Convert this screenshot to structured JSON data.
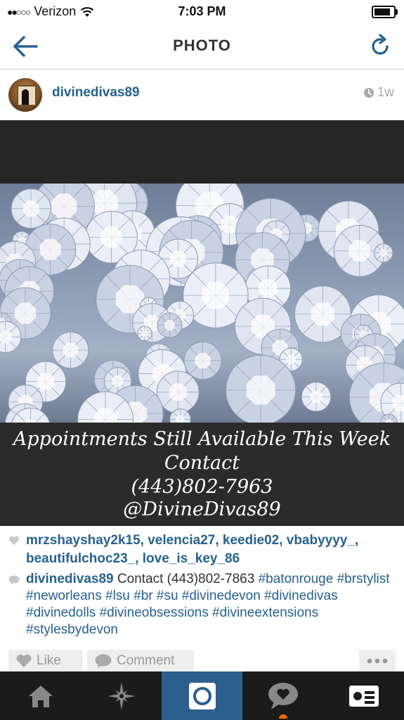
{
  "status_bar": {
    "signal_dots": "●●○○○",
    "carrier": "Verizon",
    "time": "7:03 PM",
    "battery_level": 0.85
  },
  "nav": {
    "title": "PHOTO",
    "back_icon": "arrow-left-icon",
    "refresh_icon": "refresh-icon"
  },
  "post": {
    "username": "divinedivas89",
    "time_ago": "1w",
    "image_caption": [
      "Appointments Still Available This Week",
      "Contact",
      "(443)802-7963",
      "@DivineDivas89"
    ],
    "likes": "mrzshayshay2k15, velencia27, keedie02, vbabyyyy_, beautifulchoc23_, love_is_key_86",
    "comment": {
      "username": "divinedivas89",
      "text": "Contact (443)802-7863",
      "hashtags": "#batonrouge #brstylist #neworleans #lsu #br #su #divinedevon #divinedivas #divinedolls #divineobsessions #divineextensions #stylesbydevon"
    }
  },
  "actions": {
    "like_label": "Like",
    "comment_label": "Comment"
  },
  "tab_bar": {
    "items": [
      "home-icon",
      "explore-icon",
      "camera-icon",
      "news-icon",
      "profile-icon"
    ],
    "active_index": 2
  },
  "colors": {
    "link_blue": "#26628f",
    "active_tab": "#2c5f8d",
    "tab_bar_bg": "#1b1b1b",
    "notification_dot": "#ff6a00"
  }
}
